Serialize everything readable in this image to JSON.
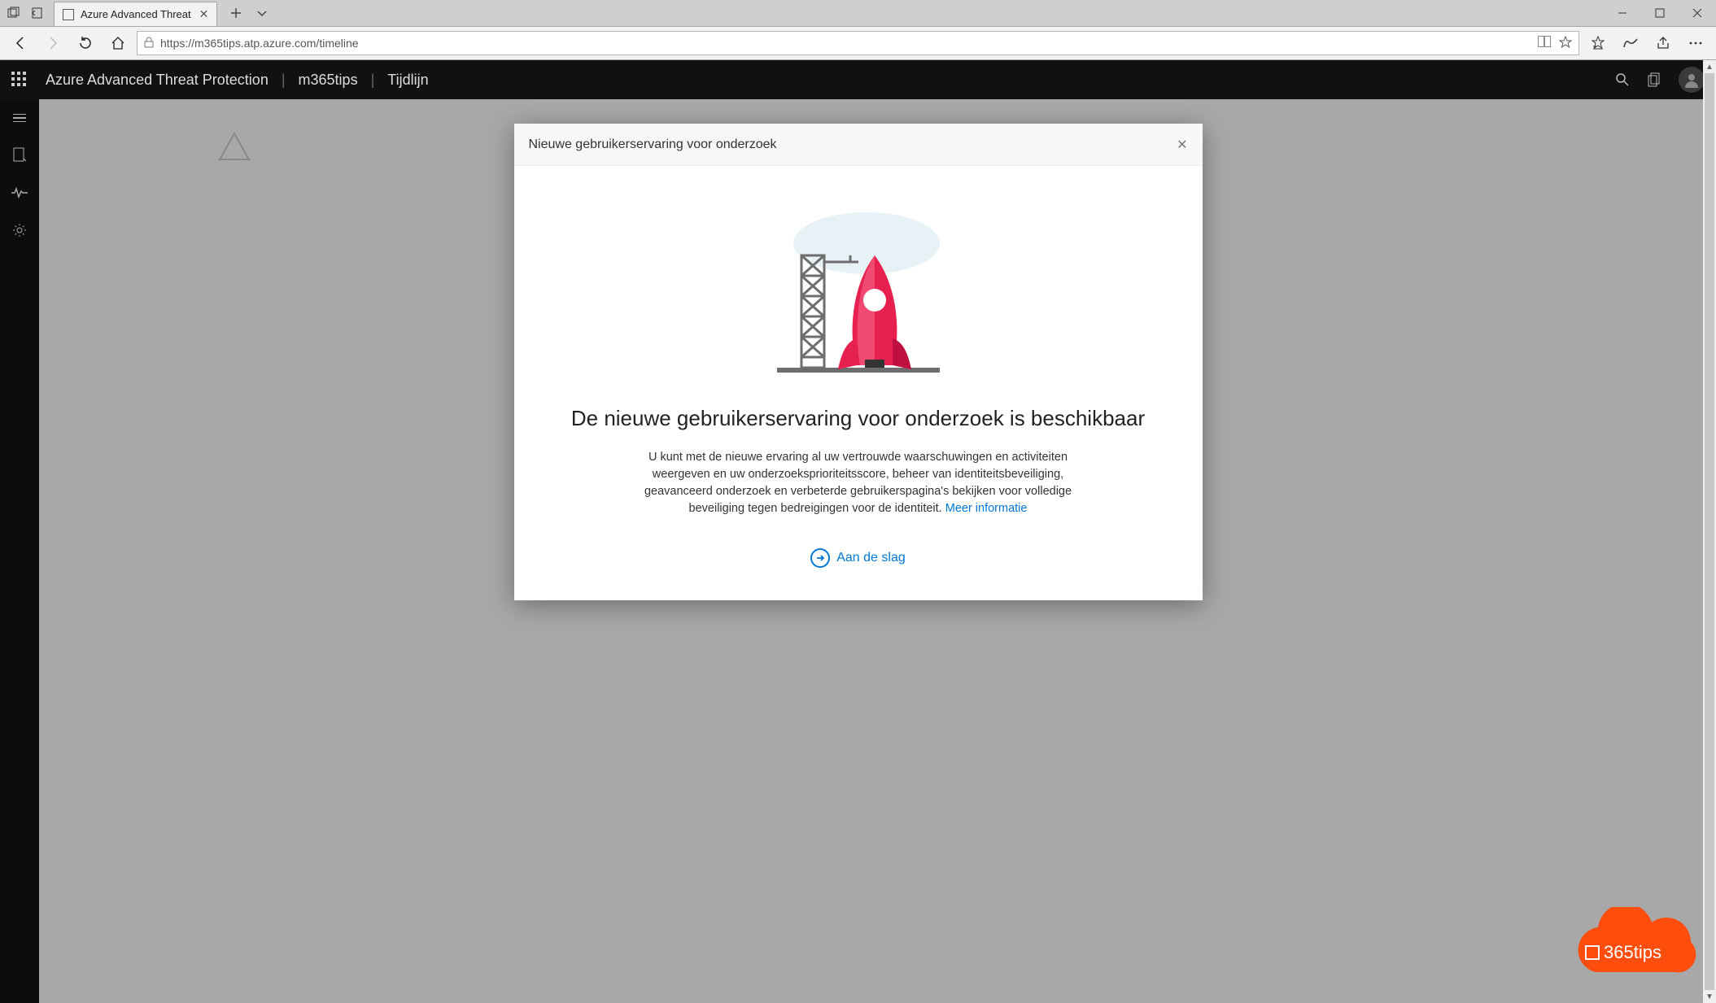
{
  "browser": {
    "tab_title": "Azure Advanced Threat",
    "url": "https://m365tips.atp.azure.com/timeline"
  },
  "header": {
    "product": "Azure Advanced Threat Protection",
    "tenant": "m365tips",
    "page": "Tijdlijn"
  },
  "modal": {
    "title": "Nieuwe gebruikerservaring voor onderzoek",
    "heading": "De nieuwe gebruikerservaring voor onderzoek is beschikbaar",
    "body": "U kunt met de nieuwe ervaring al uw vertrouwde waarschuwingen en activiteiten weergeven en uw onderzoeksprioriteitsscore, beheer van identiteitsbeveiliging, geavanceerd onderzoek en verbeterde gebruikerspagina's bekijken voor volledige beveiliging tegen bedreigingen voor de identiteit. ",
    "link_label": "Meer informatie",
    "cta_label": "Aan de slag"
  },
  "watermark": {
    "text": "365tips"
  }
}
